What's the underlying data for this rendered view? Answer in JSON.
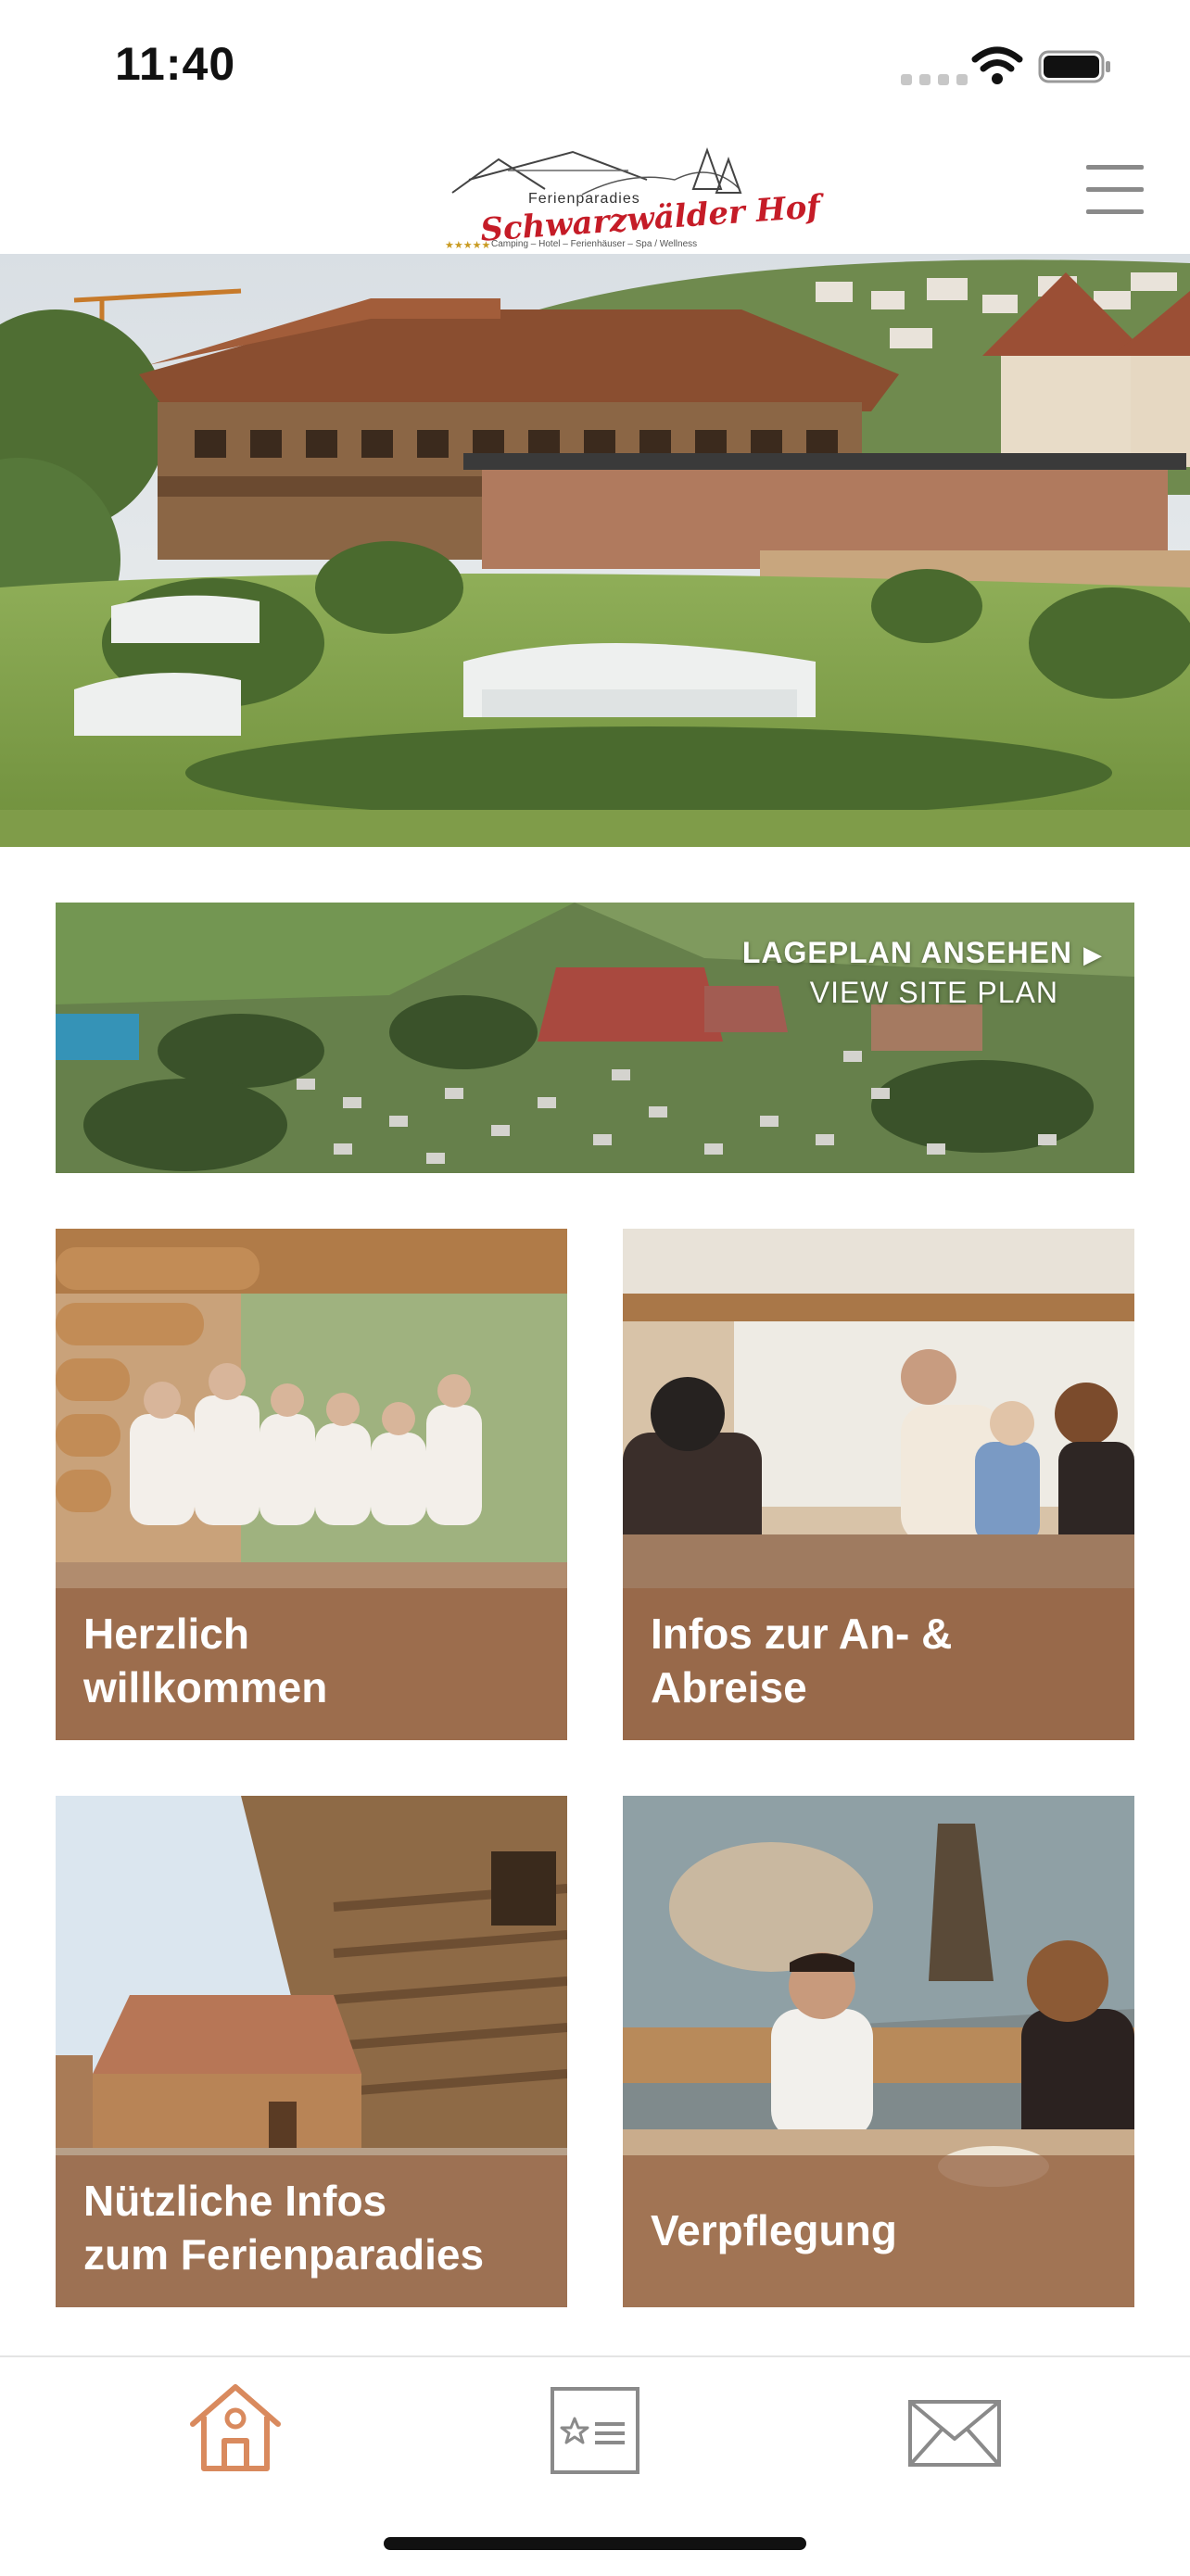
{
  "status_bar": {
    "time": "11:40"
  },
  "header": {
    "logo": {
      "small_text": "Ferienparadies",
      "script_text": "Schwarzwälder Hof",
      "stars": "★★★★★",
      "tagline": "Camping – Hotel – Ferienhäuser – Spa / Wellness"
    },
    "menu_icon": "hamburger-menu-icon"
  },
  "site_plan": {
    "title": "LAGEPLAN ANSEHEN",
    "subtitle": "VIEW SITE PLAN",
    "arrow_icon": "triangle-right-icon"
  },
  "tiles": [
    {
      "label": "Herzlich\nwillkommen"
    },
    {
      "label": "Infos zur An- &\nAbreise"
    },
    {
      "label": "Nützliche Infos\nzum Ferienparadies"
    },
    {
      "label": "Verpflegung"
    }
  ],
  "tab_bar": {
    "items": [
      {
        "icon": "home-icon",
        "active": true
      },
      {
        "icon": "favorites-list-icon",
        "active": false
      },
      {
        "icon": "envelope-icon",
        "active": false
      }
    ]
  },
  "colors": {
    "accent": "#D98A5E",
    "tile_overlay": "#96644480",
    "inactive_icon": "#8A8A8A"
  }
}
